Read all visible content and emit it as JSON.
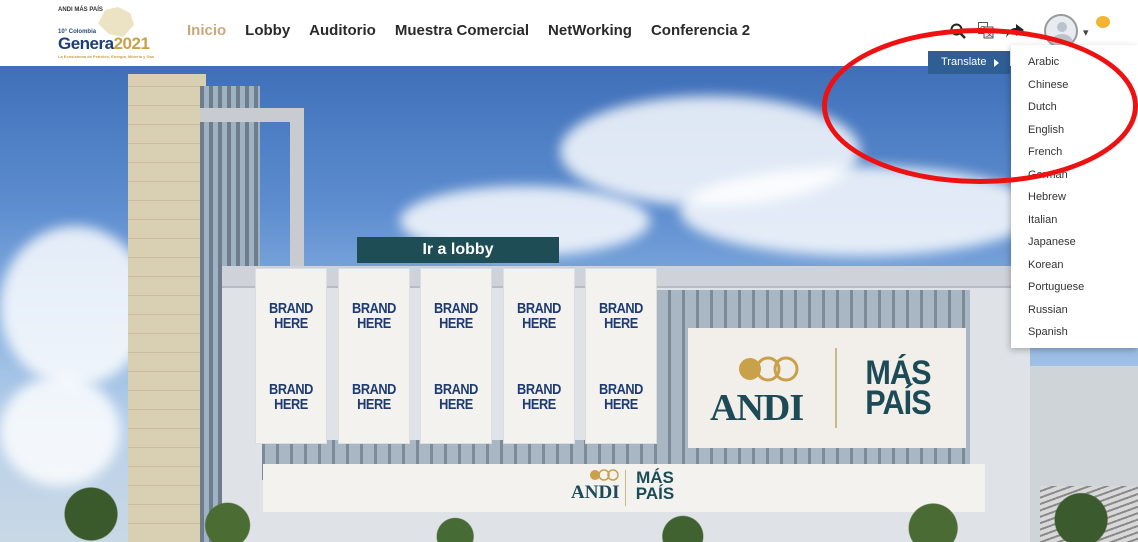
{
  "logo": {
    "top_text": "ANDI MÁS PAÍS",
    "line": "10° Colombia",
    "name": "Genera",
    "year": "2021",
    "sub": "La Ecosistema de Petróleo, Energía, Minería y Gas"
  },
  "nav": {
    "items": [
      {
        "label": "Inicio",
        "active": true
      },
      {
        "label": "Lobby",
        "active": false
      },
      {
        "label": "Auditorio",
        "active": false
      },
      {
        "label": "Muestra Comercial",
        "active": false
      },
      {
        "label": "NetWorking",
        "active": false
      },
      {
        "label": "Conferencia 2",
        "active": false
      }
    ]
  },
  "toolbar": {
    "icons": [
      "search-icon",
      "translate-icon",
      "share-icon",
      "avatar",
      "chevron-down-icon",
      "chat-icon"
    ]
  },
  "translate": {
    "button_label": "Translate",
    "languages": [
      "Arabic",
      "Chinese",
      "Dutch",
      "English",
      "French",
      "German",
      "Hebrew",
      "Italian",
      "Japanese",
      "Korean",
      "Portuguese",
      "Russian",
      "Spanish"
    ]
  },
  "scene": {
    "lobby_button": "Ir a lobby",
    "banners": [
      {
        "line1": "BRAND",
        "line2": "HERE"
      },
      {
        "line1": "BRAND",
        "line2": "HERE"
      },
      {
        "line1": "BRAND",
        "line2": "HERE"
      },
      {
        "line1": "BRAND",
        "line2": "HERE"
      },
      {
        "line1": "BRAND",
        "line2": "HERE"
      }
    ],
    "andi_word": "ANDI",
    "mas_line1": "MÁS",
    "mas_line2": "PAÍS"
  },
  "colors": {
    "nav_active": "#c9a97a",
    "translate_bg": "#2f5e94",
    "lobby_bg": "#1f4d55",
    "brand_text": "#1d3b73",
    "highlight": "#ee1111"
  }
}
